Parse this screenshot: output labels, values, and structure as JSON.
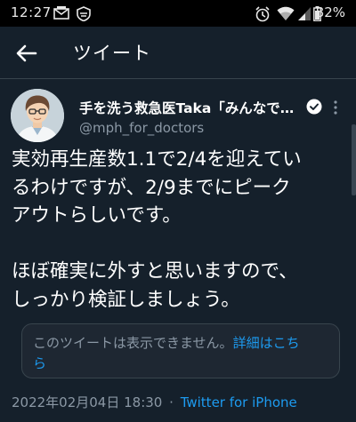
{
  "status_bar": {
    "time": "12:27",
    "battery_percent": "82%",
    "icons": [
      "mail-icon",
      "shield-icon",
      "alarm-icon",
      "wifi-icon",
      "signal-icon",
      "battery-icon"
    ]
  },
  "header": {
    "title": "ツイート",
    "back_icon": "arrow-left-icon"
  },
  "tweet": {
    "author": {
      "display_name": "手を洗う救急医Taka「みんなで…",
      "handle": "@mph_for_doctors",
      "verified": true
    },
    "text_lines": [
      "実効再生産数1.1で2/4を迎えてい",
      "るわけですが、2/9までにピーク",
      "アウトらしいです。",
      "",
      "ほぼ確実に外すと思いますので、",
      "しっかり検証しましょう。"
    ],
    "unavailable_notice": {
      "text": "このツイートは表示できません。",
      "link_text": "詳細はこち",
      "link_text_cont": "ら"
    },
    "timestamp": "2022年02月04日 18:30",
    "separator": "·",
    "source": "Twitter for iPhone"
  },
  "colors": {
    "background": "#15202b",
    "status_bar": "#000000",
    "text_primary": "#ffffff",
    "text_secondary": "#8b98a5",
    "accent": "#1d9bf0",
    "border": "#38444d"
  }
}
